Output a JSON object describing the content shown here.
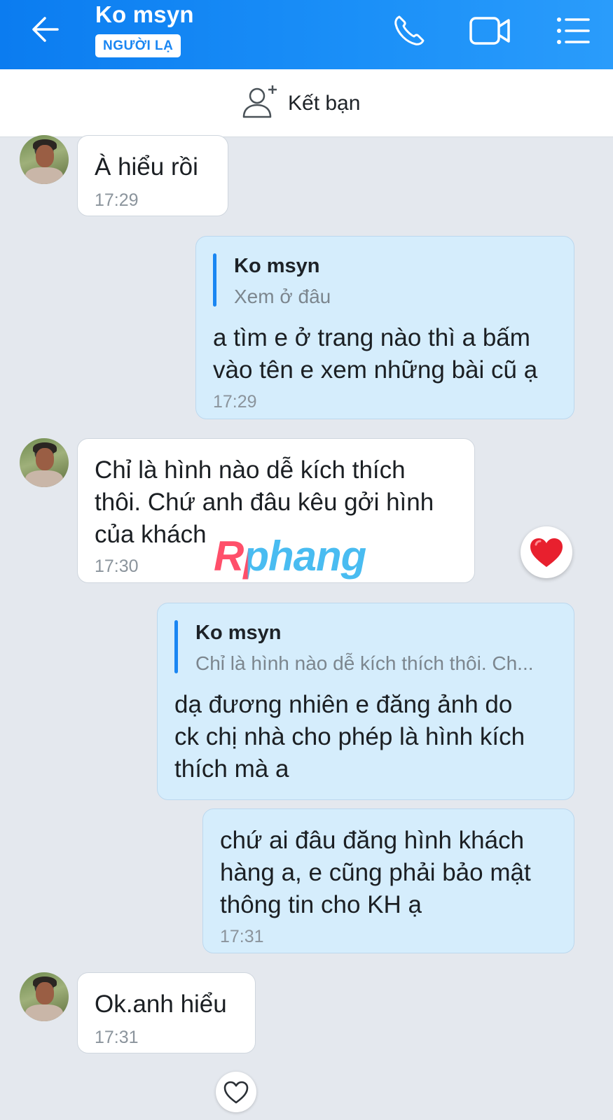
{
  "header": {
    "contact_name": "Ko msyn",
    "badge": "NGƯỜI LẠ",
    "icons": [
      "back-arrow-icon",
      "phone-icon",
      "video-camera-icon",
      "menu-list-icon"
    ]
  },
  "friend_bar": {
    "label": "Kết bạn",
    "icon": "add-person-icon"
  },
  "messages": [
    {
      "direction": "in",
      "text": [
        "À hiểu rồi"
      ],
      "time": "17:29"
    },
    {
      "direction": "out",
      "quote": {
        "name": "Ko msyn",
        "text": "Xem ở đâu"
      },
      "text": [
        "a tìm e ở trang nào thì a bấm",
        "vào tên e xem những bài cũ ạ"
      ],
      "time": "17:29"
    },
    {
      "direction": "in",
      "text": [
        "Chỉ là hình nào dễ kích thích",
        "thôi. Chứ anh đâu kêu gởi hình",
        "của khách"
      ],
      "time": "17:30",
      "reaction": "❤"
    },
    {
      "direction": "out",
      "quote": {
        "name": "Ko msyn",
        "text": "Chỉ là hình nào dễ kích thích thôi. Ch..."
      },
      "text": [
        "dạ đương nhiên e đăng ảnh do",
        "ck chị nhà cho phép là hình kích",
        "thích mà a"
      ]
    },
    {
      "direction": "out",
      "text": [
        "chứ ai đâu đăng hình khách",
        "hàng a, e cũng phải bảo mật",
        "thông tin cho KH ạ"
      ],
      "time": "17:31"
    },
    {
      "direction": "in",
      "text": [
        "Ok.anh hiểu"
      ],
      "time": "17:31",
      "react_button": "♡"
    }
  ],
  "watermark": "Rphang",
  "colors": {
    "header_blue": "#1a86f2",
    "outgoing_bubble": "#d5edfc",
    "incoming_bubble": "#ffffff",
    "chat_background": "#e4e8ee",
    "heart_red": "#e8202e"
  }
}
